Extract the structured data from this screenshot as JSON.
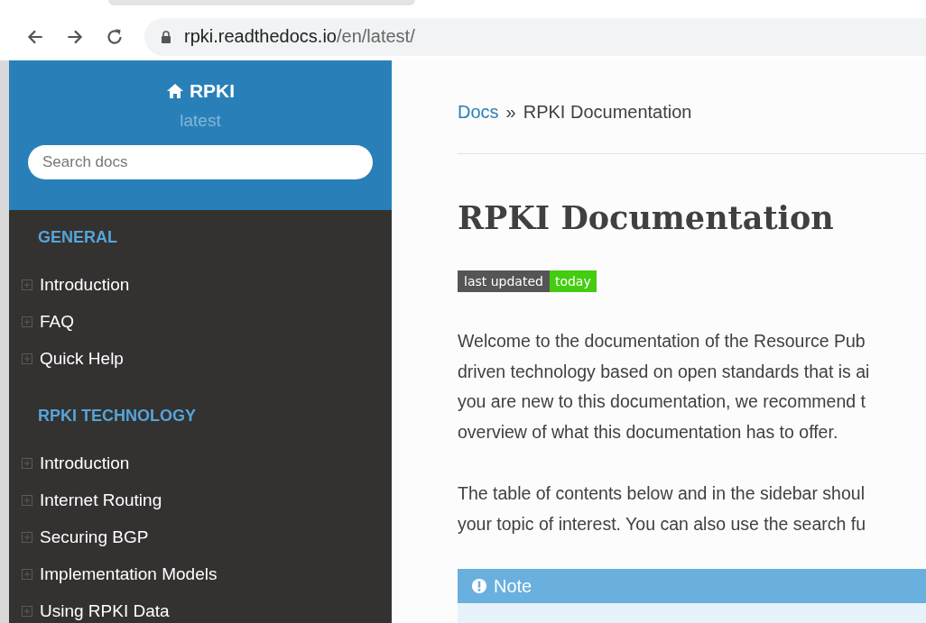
{
  "browser": {
    "url_host": "rpki.readthedocs.io",
    "url_path": "/en/latest/"
  },
  "sidebar": {
    "title": "RPKI",
    "version": "latest",
    "search": {
      "placeholder": "Search docs"
    },
    "sections": [
      {
        "caption": "GENERAL",
        "items": [
          {
            "label": "Introduction",
            "expanded": false
          },
          {
            "label": "FAQ",
            "expanded": false
          },
          {
            "label": "Quick Help",
            "expanded": false
          }
        ]
      },
      {
        "caption": "RPKI TECHNOLOGY",
        "items": [
          {
            "label": "Introduction",
            "expanded": false
          },
          {
            "label": "Internet Routing",
            "expanded": false
          },
          {
            "label": "Securing BGP",
            "expanded": false
          },
          {
            "label": "Implementation Models",
            "expanded": false
          },
          {
            "label": "Using RPKI Data",
            "expanded": false
          }
        ]
      }
    ]
  },
  "breadcrumb": {
    "link": "Docs",
    "separator": "»",
    "current": "RPKI Documentation"
  },
  "page": {
    "title": "RPKI Documentation",
    "badge": {
      "label": "last updated",
      "value": "today"
    },
    "paragraphs": [
      [
        "Welcome to the documentation of the Resource Pub",
        "driven technology based on open standards that is ai",
        "you are new to this documentation, we recommend t",
        "overview of what this documentation has to offer."
      ],
      [
        "The table of contents below and in the sidebar shoul",
        "your topic of interest. You can also use the search fu"
      ]
    ],
    "note": {
      "title": "Note"
    }
  }
}
